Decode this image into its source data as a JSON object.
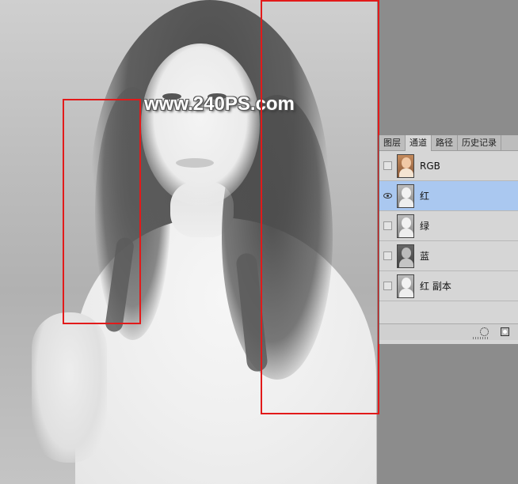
{
  "watermark": "www.240PS.com",
  "panel": {
    "tabs": [
      {
        "label": "图层",
        "active": false
      },
      {
        "label": "通道",
        "active": true
      },
      {
        "label": "路径",
        "active": false
      },
      {
        "label": "历史记录",
        "active": false
      }
    ],
    "channels": [
      {
        "label": "RGB",
        "visible": false,
        "selected": false,
        "thumb": "color"
      },
      {
        "label": "红",
        "visible": true,
        "selected": true,
        "thumb": "light"
      },
      {
        "label": "绿",
        "visible": false,
        "selected": false,
        "thumb": "light"
      },
      {
        "label": "蓝",
        "visible": false,
        "selected": false,
        "thumb": "dark"
      },
      {
        "label": "红 副本",
        "visible": false,
        "selected": false,
        "thumb": "light"
      }
    ],
    "footer_icons": [
      "dotted-circle-icon",
      "mask-icon"
    ]
  },
  "colors": {
    "selection_box": "#e21a1a",
    "selected_row": "#aac8f0",
    "panel_bg": "#d6d6d6",
    "workspace_bg": "#8c8c8c"
  }
}
